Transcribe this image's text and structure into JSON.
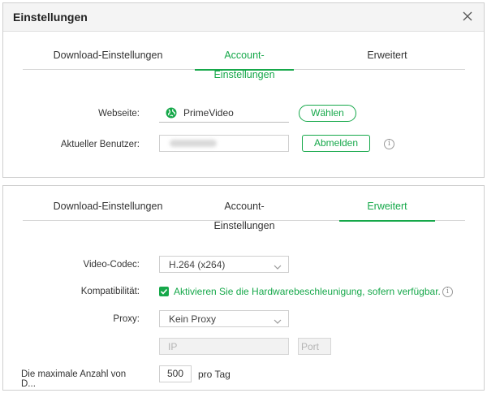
{
  "dialog": {
    "title": "Einstellungen"
  },
  "tabs": [
    "Download-Einstellungen",
    "Account-Einstellungen",
    "Erweitert"
  ],
  "account": {
    "website_label": "Webseite:",
    "website_name": "PrimeVideo",
    "choose_button": "Wählen",
    "current_user_label": "Aktueller Benutzer:",
    "logout_button": "Abmelden",
    "info_glyph": "i"
  },
  "advanced": {
    "codec_label": "Video-Codec:",
    "codec_value": "H.264 (x264)",
    "compat_label": "Kompatibilität:",
    "compat_text": "Aktivieren Sie die Hardwarebeschleunigung, sofern verfügbar.",
    "compat_checked": true,
    "proxy_label": "Proxy:",
    "proxy_value": "Kein Proxy",
    "ip_placeholder": "IP",
    "port_placeholder": "Port",
    "max_label": "Die maximale Anzahl von D...",
    "max_value": "500",
    "per_day": "pro Tag",
    "info_glyph": "i"
  },
  "colors": {
    "accent": "#16a84a",
    "border": "#cfcfcf",
    "titlebar": "#f4f4f4"
  },
  "icons": {
    "close": "close-icon",
    "website": "globe-icon",
    "info": "info-icon",
    "dropdown": "chevron-down-icon",
    "check": "check-icon"
  }
}
